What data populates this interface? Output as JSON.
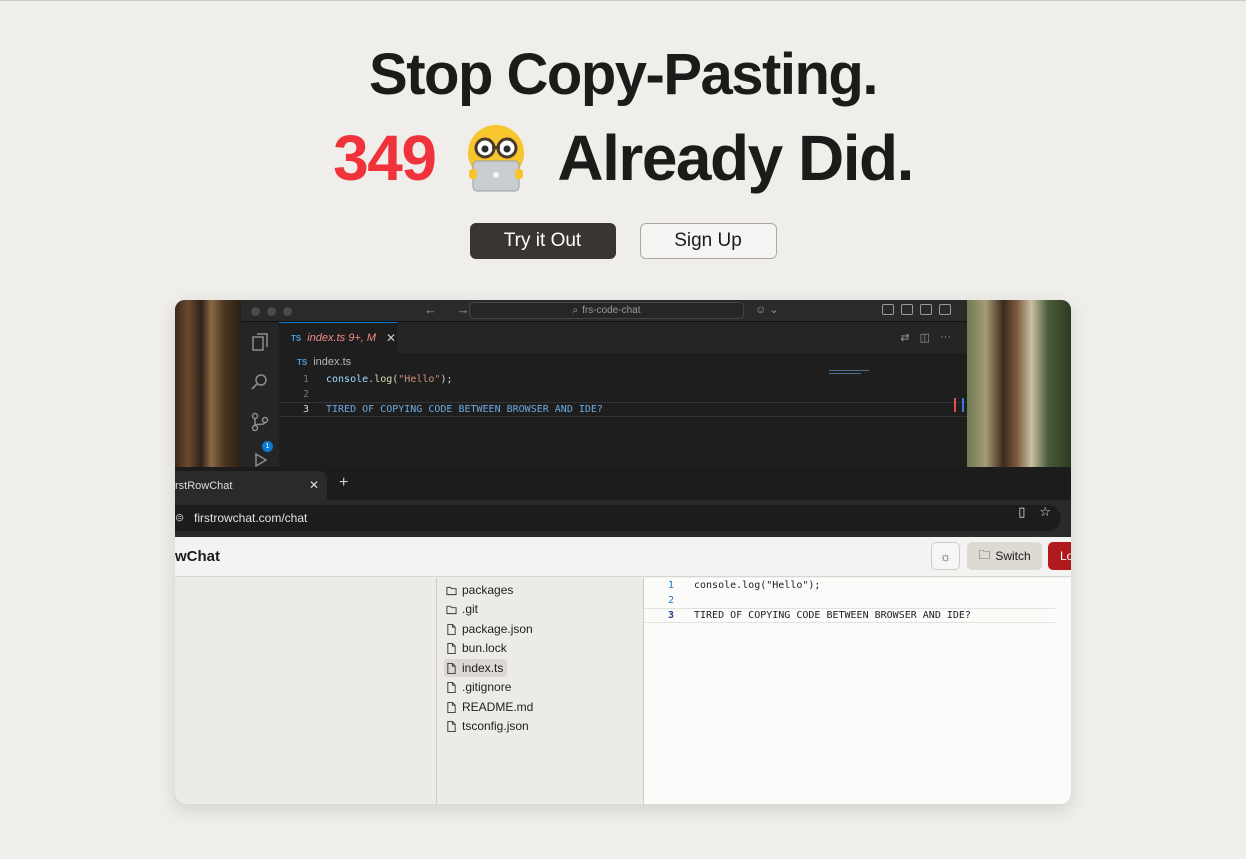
{
  "hero": {
    "headline": "Stop Copy-Pasting.",
    "count": "349",
    "emoji_icon": "nerd-face-laptop-icon",
    "tagline": "Already Did."
  },
  "actions": {
    "try_label": "Try it Out",
    "signup_label": "Sign Up"
  },
  "colors": {
    "accent_count": "#f0333b",
    "primary_button": "#3a3432",
    "page_bg": "#efeeeb"
  },
  "vscode": {
    "search_label": "frs-code-chat",
    "tab": {
      "lang": "TS",
      "label": "index.ts 9+, M"
    },
    "breadcrumb": {
      "lang": "TS",
      "file": "index.ts"
    },
    "scm_badge": "1",
    "lines": [
      {
        "num": "1",
        "fn": "console",
        "dot": ".",
        "method": "log",
        "open": "(",
        "str": "\"Hello\"",
        "close": ");"
      },
      {
        "num": "2",
        "text": ""
      },
      {
        "num": "3",
        "text": "TIRED OF COPYING CODE BETWEEN BROWSER AND IDE?"
      }
    ]
  },
  "browser": {
    "tab_title": "rstRowChat",
    "url": "firstrowchat.com/chat",
    "app_title": "wChat",
    "switch_label": "Switch",
    "logout_label": "Lo",
    "files": [
      {
        "name": "packages",
        "type": "folder"
      },
      {
        "name": ".git",
        "type": "folder"
      },
      {
        "name": "package.json",
        "type": "file"
      },
      {
        "name": "bun.lock",
        "type": "file"
      },
      {
        "name": "index.ts",
        "type": "file",
        "selected": true
      },
      {
        "name": ".gitignore",
        "type": "file"
      },
      {
        "name": "README.md",
        "type": "file"
      },
      {
        "name": "tsconfig.json",
        "type": "file"
      }
    ],
    "editor_lines": [
      {
        "num": "1",
        "text": "console.log(\"Hello\");"
      },
      {
        "num": "2",
        "text": ""
      },
      {
        "num": "3",
        "text": "TIRED OF COPYING CODE BETWEEN BROWSER AND IDE?"
      }
    ]
  }
}
